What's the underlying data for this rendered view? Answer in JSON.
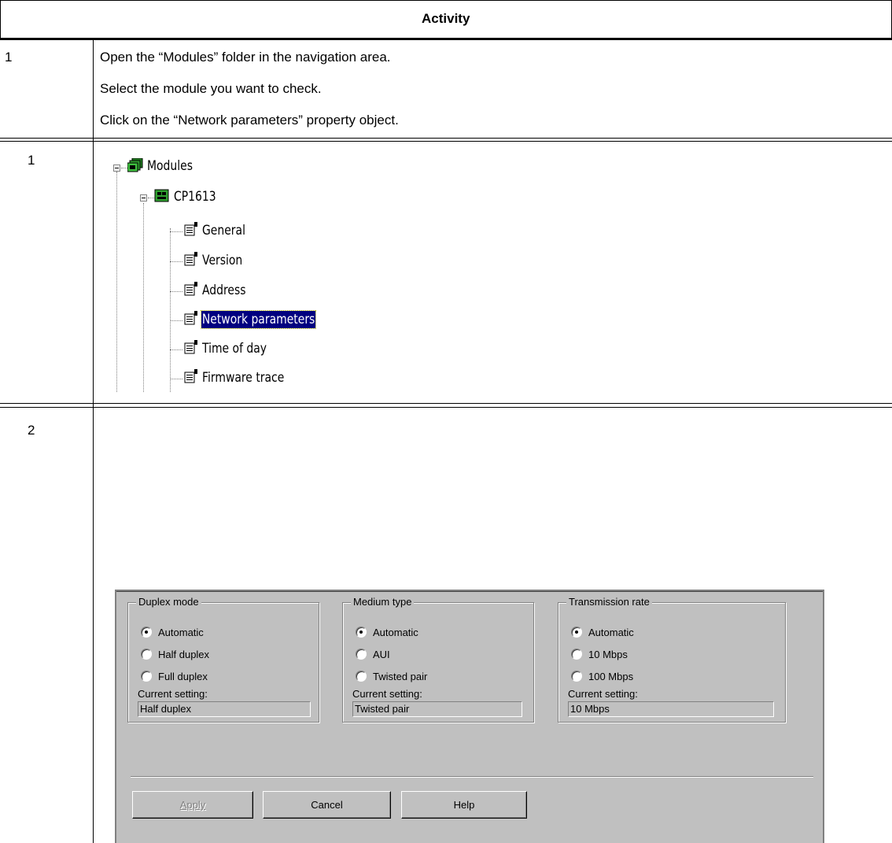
{
  "table": {
    "header": "Activity",
    "rows": [
      {
        "number": "1",
        "lines": [
          "Open the “Modules” folder in the navigation area.",
          "Select the module you want to check.",
          "Click on the “Network parameters” property object."
        ]
      },
      {
        "number": "1"
      },
      {
        "number": "2"
      }
    ]
  },
  "tree": {
    "root": {
      "label": "Modules",
      "icon": "modules-folder-icon"
    },
    "module": {
      "label": "CP1613",
      "icon": "module-card-icon"
    },
    "properties": [
      {
        "label": "General",
        "icon": "property-sheet-icon",
        "selected": false
      },
      {
        "label": "Version",
        "icon": "property-sheet-icon",
        "selected": false
      },
      {
        "label": "Address",
        "icon": "property-sheet-icon",
        "selected": false
      },
      {
        "label": "Network parameters",
        "icon": "property-sheet-icon",
        "selected": true
      },
      {
        "label": "Time of day",
        "icon": "property-sheet-icon",
        "selected": false
      },
      {
        "label": "Firmware trace",
        "icon": "property-sheet-icon",
        "selected": false
      }
    ]
  },
  "dialog": {
    "groups": [
      {
        "title": "Duplex mode",
        "options": [
          "Automatic",
          "Half duplex",
          "Full duplex"
        ],
        "selected_option": "Automatic",
        "current_label": "Current setting:",
        "current_value": "Half duplex"
      },
      {
        "title": "Medium type",
        "options": [
          "Automatic",
          "AUI",
          "Twisted pair"
        ],
        "selected_option": "Automatic",
        "current_label": "Current setting:",
        "current_value": "Twisted pair"
      },
      {
        "title": "Transmission rate",
        "options": [
          "Automatic",
          "10 Mbps",
          "100 Mbps"
        ],
        "selected_option": "Automatic",
        "current_label": "Current setting:",
        "current_value": "10 Mbps"
      }
    ],
    "buttons": {
      "apply": "Apply",
      "cancel": "Cancel",
      "help": "Help"
    },
    "apply_enabled": false
  },
  "colors": {
    "dialog_bg": "#c0c0c0",
    "selection_bg": "#000080",
    "selection_fg": "#ffffff"
  }
}
